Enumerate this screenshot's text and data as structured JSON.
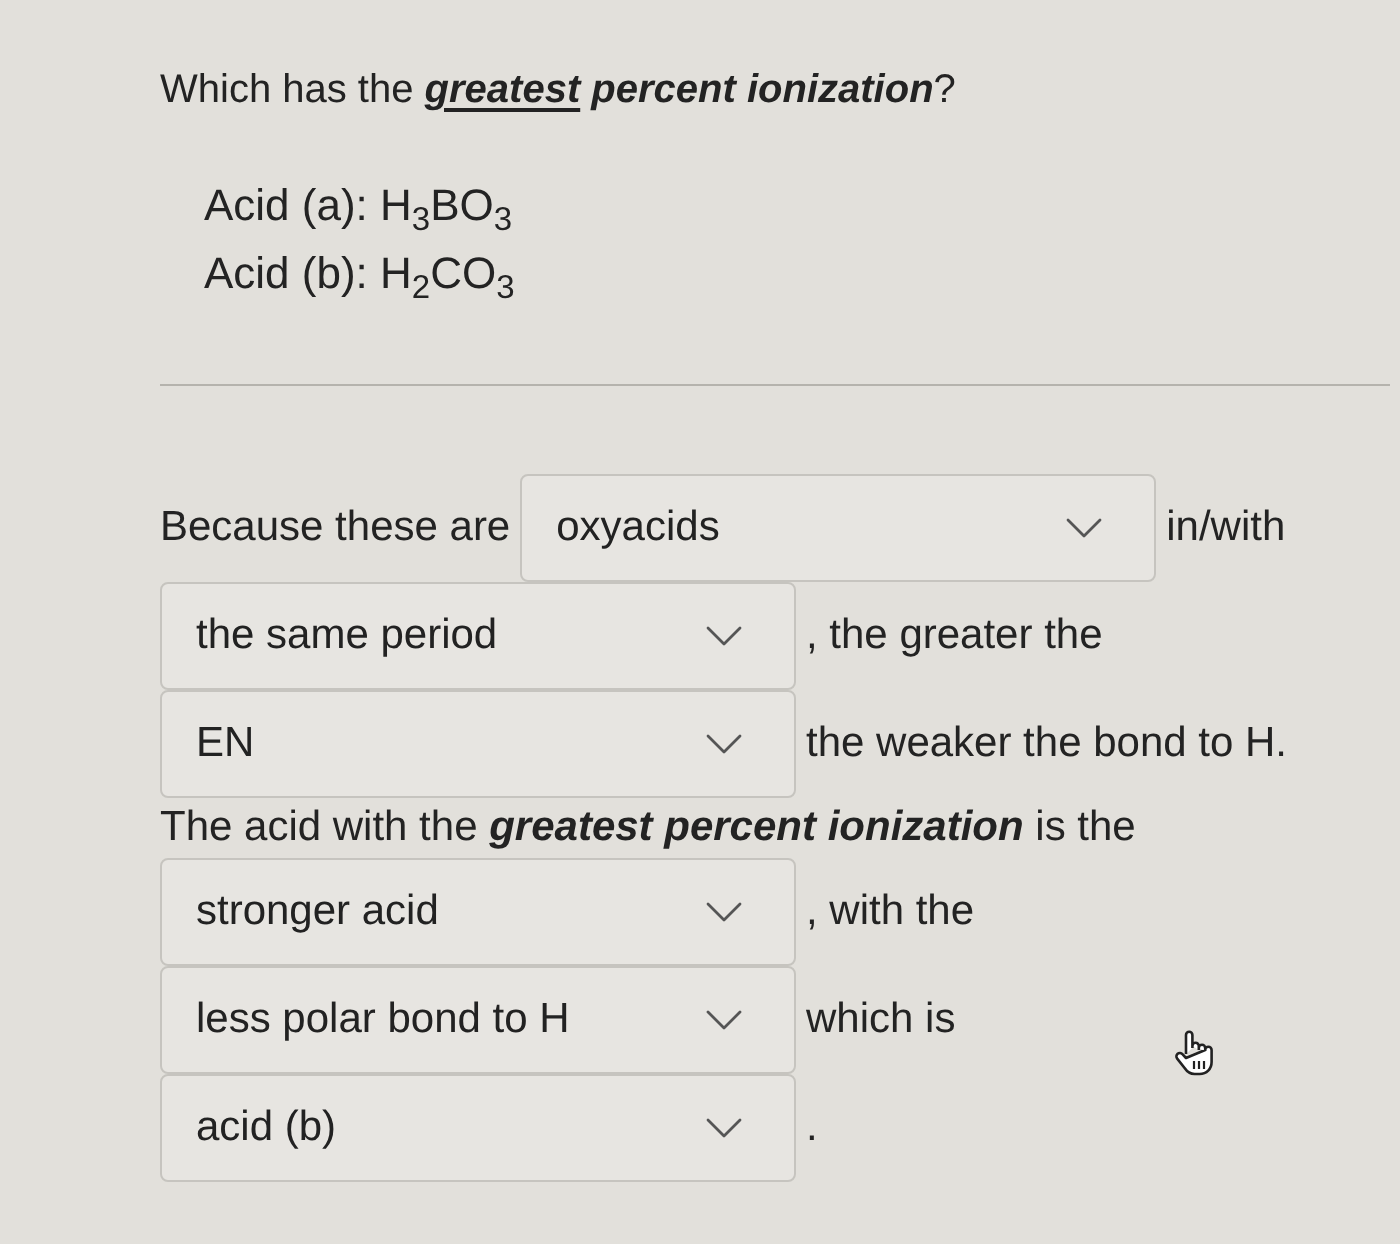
{
  "question": [
    {
      "text": "Which has the ",
      "emphasis": false,
      "underline": false
    },
    {
      "text": "greatest",
      "emphasis": true,
      "underline": true
    },
    {
      "text": " percent ionization",
      "emphasis": true,
      "underline": false
    },
    {
      "text": "?",
      "emphasis": false,
      "underline": false
    }
  ],
  "acids": [
    "Acid (a): H$_{3}$BO$_{3}$",
    "Acid (b): H$_{2}$CO$_{3}$"
  ],
  "rows": [
    {
      "items": [
        {
          "kind": "text",
          "text": "Because these are"
        },
        {
          "kind": "dropdown",
          "value": "oxyacids"
        },
        {
          "kind": "text",
          "text": "in/with"
        }
      ]
    },
    {
      "items": [
        {
          "kind": "dropdown",
          "value": "the same period"
        },
        {
          "kind": "text",
          "text": ", the greater the"
        }
      ]
    },
    {
      "items": [
        {
          "kind": "dropdown",
          "value": "EN"
        },
        {
          "kind": "text",
          "text": "the weaker the bond to H."
        }
      ]
    },
    {
      "items": [
        {
          "kind": "text",
          "text": "The acid with the **greatest percent ionization** is the"
        }
      ]
    },
    {
      "items": [
        {
          "kind": "dropdown",
          "value": "stronger acid"
        },
        {
          "kind": "text",
          "text": ", with the"
        }
      ]
    },
    {
      "items": [
        {
          "kind": "dropdown",
          "value": "less polar bond to H"
        },
        {
          "kind": "text",
          "text": "which is"
        }
      ]
    },
    {
      "items": [
        {
          "kind": "dropdown",
          "value": "acid (b)"
        },
        {
          "kind": "text",
          "text": "."
        }
      ]
    }
  ]
}
